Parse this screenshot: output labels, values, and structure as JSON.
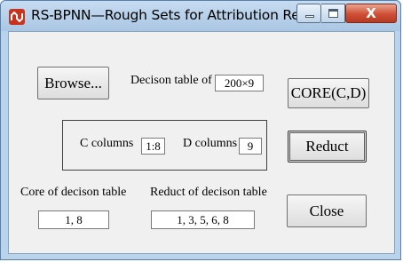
{
  "window": {
    "title": "RS-BPNN—Rough Sets for Attribution Redu...",
    "controls": {
      "minimize": "minimize",
      "maximize": "maximize",
      "close": "X"
    }
  },
  "main": {
    "browse_label": "Browse...",
    "decision_table_label": "Decison table of",
    "decision_table_value": "200×9",
    "core_cd_label": "CORE(C,D)",
    "c_columns_label": "C columns",
    "c_columns_value": "1:8",
    "d_columns_label": "D columns",
    "d_columns_value": "9",
    "reduct_label": "Reduct",
    "core_table_label": "Core of decison table",
    "core_table_value": "1, 8",
    "reduct_table_label": "Reduct of decison table",
    "reduct_table_value": "1, 3, 5, 6, 8",
    "close_label": "Close"
  },
  "icons": {
    "app": "app-icon",
    "minimize": "minimize-icon",
    "maximize": "maximize-icon",
    "close": "close-icon"
  },
  "colors": {
    "titlebar": "#b9d3ec",
    "close_button": "#cf4f36",
    "app_icon": "#c8321e",
    "client_bg": "#f0f0f0"
  }
}
